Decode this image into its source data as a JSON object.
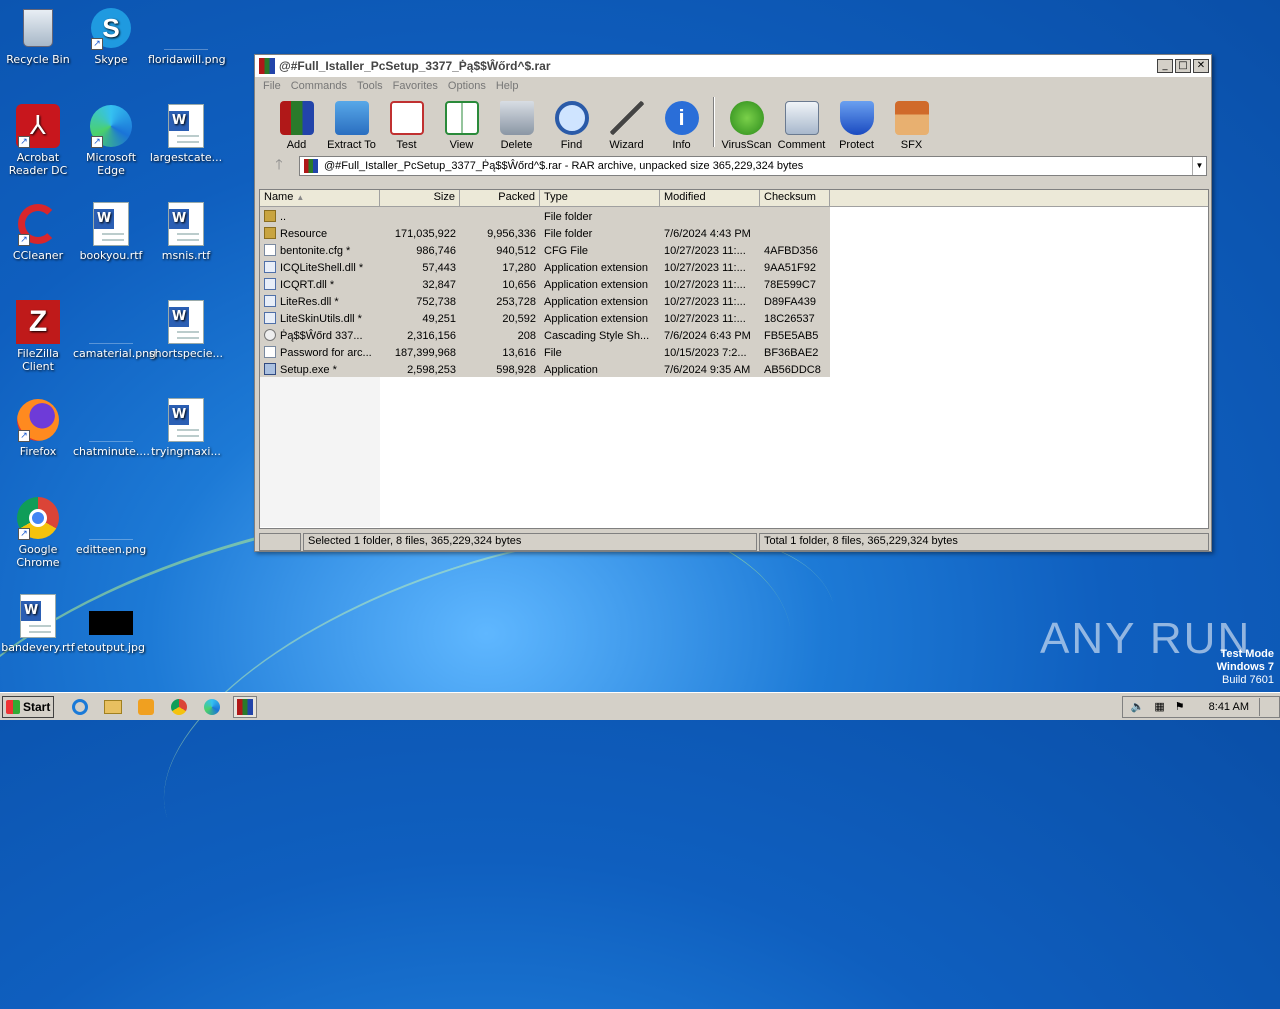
{
  "desktop": {
    "icons": [
      {
        "label": "Recycle Bin"
      },
      {
        "label": "Skype"
      },
      {
        "label": "floridawill.png"
      },
      {
        "label": "Acrobat Reader DC"
      },
      {
        "label": "Microsoft Edge"
      },
      {
        "label": "largestcate..."
      },
      {
        "label": "CCleaner"
      },
      {
        "label": "bookyou.rtf"
      },
      {
        "label": "msnis.rtf"
      },
      {
        "label": "FileZilla Client"
      },
      {
        "label": "camaterial.png"
      },
      {
        "label": "shortspecie..."
      },
      {
        "label": "Firefox"
      },
      {
        "label": "chatminute...."
      },
      {
        "label": "tryingmaxi..."
      },
      {
        "label": "Google Chrome"
      },
      {
        "label": "editteen.png"
      },
      {
        "label": "bandevery.rtf"
      },
      {
        "label": "etoutput.jpg"
      }
    ]
  },
  "window": {
    "title": "@#Full_Istaller_PcSetup_3377_Ṗą$$Ŵőrd^$.rar",
    "menu": [
      "File",
      "Commands",
      "Tools",
      "Favorites",
      "Options",
      "Help"
    ],
    "toolbar": [
      "Add",
      "Extract To",
      "Test",
      "View",
      "Delete",
      "Find",
      "Wizard",
      "Info",
      "VirusScan",
      "Comment",
      "Protect",
      "SFX"
    ],
    "address": "@#Full_Istaller_PcSetup_3377_Ṗą$$Ŵőrd^$.rar - RAR archive, unpacked size 365,229,324 bytes",
    "columns": [
      "Name",
      "Size",
      "Packed",
      "Type",
      "Modified",
      "Checksum"
    ],
    "rows": [
      {
        "name": "..",
        "size": "",
        "packed": "",
        "type": "File folder",
        "modified": "",
        "checksum": ""
      },
      {
        "name": "Resource",
        "size": "171,035,922",
        "packed": "9,956,336",
        "type": "File folder",
        "modified": "7/6/2024 4:43 PM",
        "checksum": ""
      },
      {
        "name": "bentonite.cfg *",
        "size": "986,746",
        "packed": "940,512",
        "type": "CFG File",
        "modified": "10/27/2023 11:...",
        "checksum": "4AFBD356"
      },
      {
        "name": "ICQLiteShell.dll *",
        "size": "57,443",
        "packed": "17,280",
        "type": "Application extension",
        "modified": "10/27/2023 11:...",
        "checksum": "9AA51F92"
      },
      {
        "name": "ICQRT.dll *",
        "size": "32,847",
        "packed": "10,656",
        "type": "Application extension",
        "modified": "10/27/2023 11:...",
        "checksum": "78E599C7"
      },
      {
        "name": "LiteRes.dll *",
        "size": "752,738",
        "packed": "253,728",
        "type": "Application extension",
        "modified": "10/27/2023 11:...",
        "checksum": "D89FA439"
      },
      {
        "name": "LiteSkinUtils.dll *",
        "size": "49,251",
        "packed": "20,592",
        "type": "Application extension",
        "modified": "10/27/2023 11:...",
        "checksum": "18C26537"
      },
      {
        "name": "Ṗą$$Ŵőrd    337...",
        "size": "2,316,156",
        "packed": "208",
        "type": "Cascading Style Sh...",
        "modified": "7/6/2024 6:43 PM",
        "checksum": "FB5E5AB5"
      },
      {
        "name": "Password for arc...",
        "size": "187,399,968",
        "packed": "13,616",
        "type": "File",
        "modified": "10/15/2023 7:2...",
        "checksum": "BF36BAE2"
      },
      {
        "name": "Setup.exe *",
        "size": "2,598,253",
        "packed": "598,928",
        "type": "Application",
        "modified": "7/6/2024 9:35 AM",
        "checksum": "AB56DDC8"
      }
    ],
    "status_left": "Selected 1 folder, 8 files, 365,229,324 bytes",
    "status_right": "Total 1 folder, 8 files, 365,229,324 bytes"
  },
  "taskbar": {
    "start": "Start",
    "clock": "8:41 AM"
  },
  "watermark": {
    "brand": "ANY RUN",
    "line1": "Test Mode",
    "line2": "Windows 7",
    "line3": "Build 7601"
  }
}
